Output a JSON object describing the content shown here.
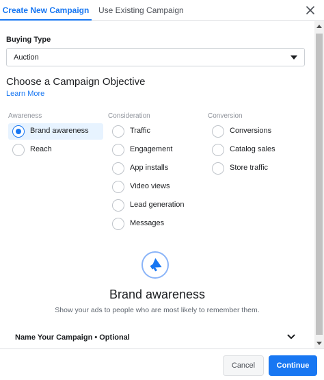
{
  "tabs": {
    "create": "Create New Campaign",
    "existing": "Use Existing Campaign"
  },
  "buying_type": {
    "label": "Buying Type",
    "value": "Auction"
  },
  "objective": {
    "title": "Choose a Campaign Objective",
    "learn_more": "Learn More",
    "columns": {
      "awareness": {
        "heading": "Awareness",
        "options": [
          "Brand awareness",
          "Reach"
        ]
      },
      "consideration": {
        "heading": "Consideration",
        "options": [
          "Traffic",
          "Engagement",
          "App installs",
          "Video views",
          "Lead generation",
          "Messages"
        ]
      },
      "conversion": {
        "heading": "Conversion",
        "options": [
          "Conversions",
          "Catalog sales",
          "Store traffic"
        ]
      }
    },
    "selected": "Brand awareness"
  },
  "detail": {
    "icon": "megaphone-icon",
    "title": "Brand awareness",
    "description": "Show your ads to people who are most likely to remember them."
  },
  "name_section": {
    "label": "Name Your Campaign • Optional"
  },
  "footer": {
    "cancel": "Cancel",
    "continue": "Continue"
  },
  "colors": {
    "accent": "#1877f2",
    "selected_bg": "#e7f3ff"
  }
}
